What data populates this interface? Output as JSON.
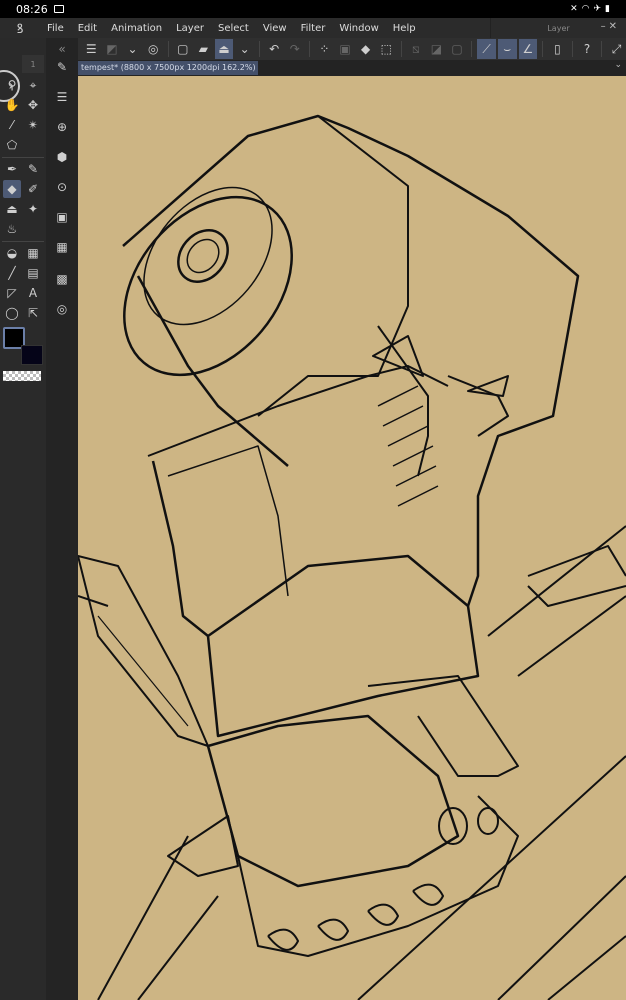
{
  "status_bar": {
    "time": "08:26",
    "icons": [
      "image-notification-icon",
      "mute-icon",
      "wifi-icon",
      "airplane-icon",
      "battery-icon"
    ]
  },
  "menu": {
    "items": [
      "File",
      "Edit",
      "Animation",
      "Layer",
      "Select",
      "View",
      "Filter",
      "Window",
      "Help"
    ]
  },
  "layer_panel": {
    "title": "Layer"
  },
  "document_tab": {
    "label": "tempest* (8800 x 7500px 1200dpi 162.2%)",
    "modified_dot": "●"
  },
  "brush_size_indicator": "1",
  "colors": {
    "canvas": "#cdb584",
    "foreground": "#000000",
    "background": "#050418",
    "accent": "#4d5a75"
  },
  "tools": {
    "active": "eraser"
  }
}
